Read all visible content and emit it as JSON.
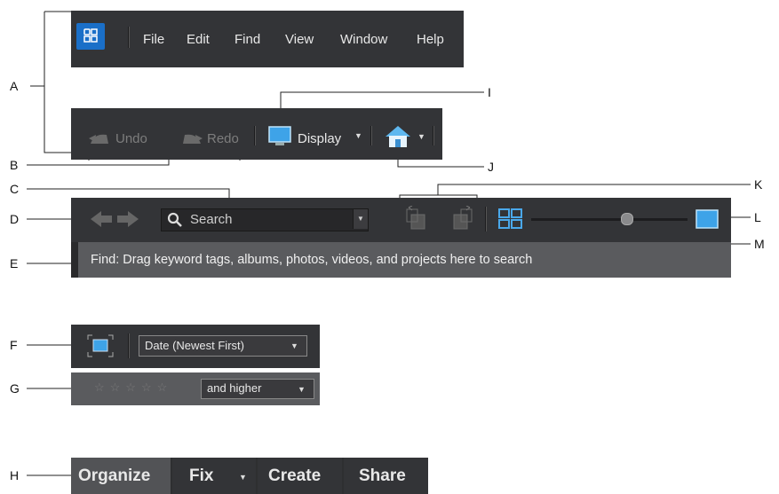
{
  "callouts": [
    "A",
    "B",
    "C",
    "D",
    "E",
    "F",
    "G",
    "H",
    "I",
    "J",
    "K",
    "L",
    "M"
  ],
  "menubar": {
    "items": [
      "File",
      "Edit",
      "Find",
      "View",
      "Window",
      "Help"
    ]
  },
  "toolbar": {
    "undo": "Undo",
    "redo": "Redo",
    "display": "Display"
  },
  "search": {
    "placeholder": "Search",
    "find_text": "Find: Drag keyword tags, albums, photos, videos, and projects here to search"
  },
  "sort": {
    "selected": "Date (Newest First)"
  },
  "rating": {
    "selected": "and higher",
    "stars": 5
  },
  "tabs": [
    "Organize",
    "Fix",
    "Create",
    "Share"
  ],
  "colors": {
    "accent": "#1a6fc8",
    "panel": "#333437",
    "find_bar": "#5a5b5e"
  }
}
